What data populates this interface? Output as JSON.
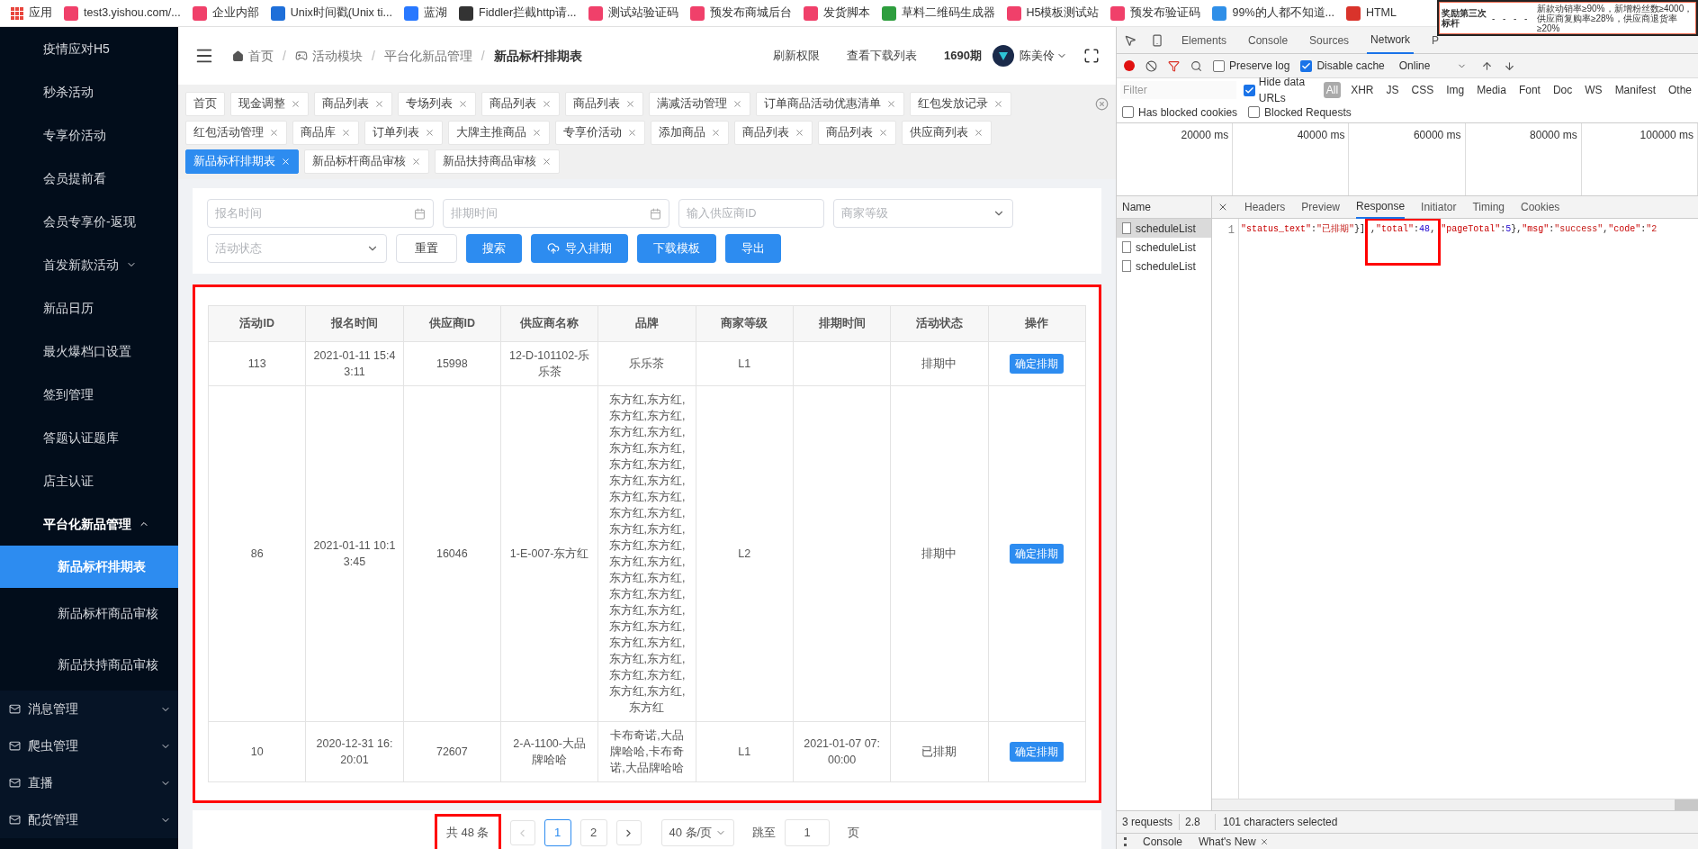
{
  "bookmarks": [
    {
      "label": "应用",
      "color": "#e8453c"
    },
    {
      "label": "test3.yishou.com/...",
      "color": "#f0406a"
    },
    {
      "label": "企业内部",
      "color": "#f0406a"
    },
    {
      "label": "Unix时间戳(Unix ti...",
      "color": "#1e6fd9"
    },
    {
      "label": "蓝湖",
      "color": "#2878ff"
    },
    {
      "label": "Fiddler拦截http请...",
      "color": "#333333"
    },
    {
      "label": "测试站验证码",
      "color": "#f0406a"
    },
    {
      "label": "预发布商城后台",
      "color": "#f0406a"
    },
    {
      "label": "发货脚本",
      "color": "#f0406a"
    },
    {
      "label": "草料二维码生成器",
      "color": "#2e9e3e"
    },
    {
      "label": "H5模板测试站",
      "color": "#f0406a"
    },
    {
      "label": "预发布验证码",
      "color": "#f0406a"
    },
    {
      "label": "99%的人都不知道...",
      "color": "#2f8fe8"
    },
    {
      "label": "HTML",
      "color": "#d9332b"
    }
  ],
  "overlay_window": {
    "cells": [
      "奖励第三次标杆",
      "-",
      "-",
      "-",
      "-",
      "新款动销率≥90%，新增粉丝数≥4000，供应商复购率≥28%，供应商退货率≥20%"
    ]
  },
  "sidebar": {
    "items": [
      {
        "kind": "link",
        "label": "疫情应对H5"
      },
      {
        "kind": "link",
        "label": "秒杀活动"
      },
      {
        "kind": "link",
        "label": "专享价活动"
      },
      {
        "kind": "link",
        "label": "会员提前看"
      },
      {
        "kind": "link",
        "label": "会员专享价-返现"
      },
      {
        "kind": "submenu",
        "label": "首发新款活动",
        "expanded": false
      },
      {
        "kind": "link",
        "label": "新品日历"
      },
      {
        "kind": "link",
        "label": "最火爆档口设置"
      },
      {
        "kind": "link",
        "label": "签到管理"
      },
      {
        "kind": "link",
        "label": "答题认证题库"
      },
      {
        "kind": "link",
        "label": "店主认证"
      },
      {
        "kind": "submenu",
        "label": "平台化新品管理",
        "expanded": true,
        "children": [
          {
            "label": "新品标杆排期表",
            "selected": true
          },
          {
            "label": "新品标杆商品审核",
            "selected": false
          },
          {
            "label": "新品扶持商品审核",
            "selected": false
          }
        ]
      },
      {
        "kind": "group",
        "label": "消息管理",
        "expanded": false
      },
      {
        "kind": "group",
        "label": "爬虫管理",
        "expanded": false
      },
      {
        "kind": "group",
        "label": "直播",
        "expanded": false
      },
      {
        "kind": "group",
        "label": "配货管理",
        "expanded": false
      }
    ]
  },
  "header": {
    "breadcrumb": [
      {
        "label": "首页",
        "kind": "home"
      },
      {
        "label": "活动模块",
        "kind": "module"
      },
      {
        "label": "平台化新品管理",
        "kind": "plain"
      },
      {
        "label": "新品标杆排期表",
        "kind": "current"
      }
    ],
    "separator": "/",
    "links": [
      "刷新权限",
      "查看下载列表"
    ],
    "period": "1690期",
    "user": "陈美伶"
  },
  "tabs": [
    {
      "label": "首页",
      "selected": false,
      "closable": false
    },
    {
      "label": "现金调整",
      "selected": false,
      "closable": true
    },
    {
      "label": "商品列表",
      "selected": false,
      "closable": true
    },
    {
      "label": "专场列表",
      "selected": false,
      "closable": true
    },
    {
      "label": "商品列表",
      "selected": false,
      "closable": true
    },
    {
      "label": "商品列表",
      "selected": false,
      "closable": true
    },
    {
      "label": "满减活动管理",
      "selected": false,
      "closable": true
    },
    {
      "label": "订单商品活动优惠清单",
      "selected": false,
      "closable": true
    },
    {
      "label": "红包发放记录",
      "selected": false,
      "closable": true
    },
    {
      "label": "红包活动管理",
      "selected": false,
      "closable": true
    },
    {
      "label": "商品库",
      "selected": false,
      "closable": true
    },
    {
      "label": "订单列表",
      "selected": false,
      "closable": true
    },
    {
      "label": "大牌主推商品",
      "selected": false,
      "closable": true
    },
    {
      "label": "专享价活动",
      "selected": false,
      "closable": true
    },
    {
      "label": "添加商品",
      "selected": false,
      "closable": true
    },
    {
      "label": "商品列表",
      "selected": false,
      "closable": true
    },
    {
      "label": "商品列表",
      "selected": false,
      "closable": true
    },
    {
      "label": "供应商列表",
      "selected": false,
      "closable": true
    },
    {
      "label": "新品标杆排期表",
      "selected": true,
      "closable": true
    },
    {
      "label": "新品标杆商品审核",
      "selected": false,
      "closable": true
    },
    {
      "label": "新品扶持商品审核",
      "selected": false,
      "closable": true
    }
  ],
  "filters": [
    {
      "kind": "date",
      "placeholder": "报名时间"
    },
    {
      "kind": "date",
      "placeholder": "排期时间"
    },
    {
      "kind": "input",
      "placeholder": "输入供应商ID"
    },
    {
      "kind": "select",
      "placeholder": "商家等级"
    },
    {
      "kind": "select",
      "placeholder": "活动状态"
    }
  ],
  "actions": [
    {
      "label": "重置",
      "kind": "default"
    },
    {
      "label": "搜索",
      "kind": "primary"
    },
    {
      "label": "导入排期",
      "kind": "upload"
    },
    {
      "label": "下载模板",
      "kind": "primary"
    },
    {
      "label": "导出",
      "kind": "primary"
    }
  ],
  "table": {
    "highlighted": true,
    "columns": [
      "活动ID",
      "报名时间",
      "供应商ID",
      "供应商名称",
      "品牌",
      "商家等级",
      "排期时间",
      "活动状态",
      "操作"
    ],
    "rows": [
      {
        "cells": [
          "113",
          "2021-01-11 15:43:11",
          "15998",
          "12-D-101102-乐乐茶",
          "乐乐茶",
          "L1",
          "",
          "排期中"
        ],
        "action": "确定排期"
      },
      {
        "cells": [
          "86",
          "2021-01-11 10:13:45",
          "16046",
          "1-E-007-东方红",
          "东方红,东方红,东方红,东方红,东方红,东方红,东方红,东方红,东方红,东方红,东方红,东方红,东方红,东方红,东方红,东方红,东方红,东方红,东方红,东方红,东方红,东方红,东方红,东方红,东方红,东方红,东方红,东方红,东方红,东方红,东方红,东方红,东方红,东方红,东方红,东方红,东方红,东方红,东方红",
          "L2",
          "",
          "排期中"
        ],
        "action": "确定排期"
      },
      {
        "cells": [
          "10",
          "2020-12-31 16:20:01",
          "72607",
          "2-A-1100-大品牌哈哈",
          "卡布奇诺,大品牌哈哈,卡布奇诺,大品牌哈哈",
          "L1",
          "2021-01-07 07:00:00",
          "已排期"
        ],
        "action": "确定排期"
      }
    ]
  },
  "pagination": {
    "total": "共 48 条",
    "total_highlighted": true,
    "pages": [
      {
        "label": "1",
        "selected": true
      },
      {
        "label": "2",
        "selected": false
      }
    ],
    "page_size": "40 条/页",
    "jump_label": "跳至",
    "jump_value": "1",
    "jump_suffix": "页"
  },
  "devtools": {
    "tabs": [
      {
        "label": "Elements",
        "selected": false
      },
      {
        "label": "Console",
        "selected": false
      },
      {
        "label": "Sources",
        "selected": false
      },
      {
        "label": "Network",
        "selected": true
      },
      {
        "label": "P",
        "selected": false
      }
    ],
    "preserve_log": false,
    "disable_cache": true,
    "throttling": "Online",
    "filter_placeholder": "Filter",
    "hide_data_urls": true,
    "hide_data_urls_label": "Hide data URLs",
    "preserve_log_label": "Preserve log",
    "disable_cache_label": "Disable cache",
    "types": [
      {
        "label": "All",
        "selected": true
      },
      {
        "label": "XHR",
        "selected": false
      },
      {
        "label": "JS",
        "selected": false
      },
      {
        "label": "CSS",
        "selected": false
      },
      {
        "label": "Img",
        "selected": false
      },
      {
        "label": "Media",
        "selected": false
      },
      {
        "label": "Font",
        "selected": false
      },
      {
        "label": "Doc",
        "selected": false
      },
      {
        "label": "WS",
        "selected": false
      },
      {
        "label": "Manifest",
        "selected": false
      },
      {
        "label": "Othe",
        "selected": false
      }
    ],
    "blocked": [
      {
        "label": "Has blocked cookies",
        "checked": false
      },
      {
        "label": "Blocked Requests",
        "checked": false
      }
    ],
    "timeline": [
      "20000 ms",
      "40000 ms",
      "60000 ms",
      "80000 ms",
      "100000 ms"
    ],
    "name_header": "Name",
    "requests": [
      {
        "label": "scheduleList",
        "selected": true
      },
      {
        "label": "scheduleList",
        "selected": false
      },
      {
        "label": "scheduleList",
        "selected": false
      }
    ],
    "detail_tabs": [
      {
        "label": "Headers",
        "selected": false
      },
      {
        "label": "Preview",
        "selected": false
      },
      {
        "label": "Response",
        "selected": true
      },
      {
        "label": "Initiator",
        "selected": false
      },
      {
        "label": "Timing",
        "selected": false
      },
      {
        "label": "Cookies",
        "selected": false
      }
    ],
    "line_number": "1",
    "response": [
      {
        "kind": "key",
        "text": "\"status_text\""
      },
      {
        "kind": "punct",
        "text": ":"
      },
      {
        "kind": "string",
        "text": "\"已排期\""
      },
      {
        "kind": "punct",
        "text": "}]"
      },
      {
        "kind": "punct",
        "text": ",",
        "boxed": true
      },
      {
        "kind": "key",
        "text": "\"total\"",
        "boxed": true
      },
      {
        "kind": "punct",
        "text": ":",
        "boxed": true
      },
      {
        "kind": "number",
        "text": "48",
        "boxed": true
      },
      {
        "kind": "punct",
        "text": ",",
        "boxed": true
      },
      {
        "kind": "key",
        "text": "\"pageTotal\""
      },
      {
        "kind": "punct",
        "text": ":"
      },
      {
        "kind": "number",
        "text": "5"
      },
      {
        "kind": "punct",
        "text": "},"
      },
      {
        "kind": "key",
        "text": "\"msg\""
      },
      {
        "kind": "punct",
        "text": ":"
      },
      {
        "kind": "string",
        "text": "\"success\""
      },
      {
        "kind": "punct",
        "text": ","
      },
      {
        "kind": "key",
        "text": "\"code\""
      },
      {
        "kind": "punct",
        "text": ":"
      },
      {
        "kind": "string",
        "text": "\"2"
      }
    ],
    "status": [
      "3 requests",
      "2.8",
      "101 characters selected"
    ],
    "drawer": [
      {
        "label": "Console",
        "closable": false
      },
      {
        "label": "What's New",
        "closable": true
      }
    ]
  }
}
